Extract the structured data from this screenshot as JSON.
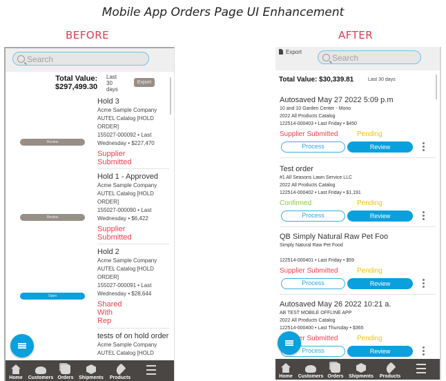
{
  "title": "Mobile App Orders Page UI Enhancement",
  "before": {
    "label": "BEFORE",
    "search_placeholder": "Search",
    "total_label": "Total Value:",
    "total_value": "$297,499.30",
    "period": [
      "Last",
      "30",
      "days"
    ],
    "export_label": "Export",
    "orders": [
      {
        "title": "Hold 3",
        "lines": [
          "Acme Sample Company",
          "AUTEL Catalog [HOLD",
          "ORDER]",
          "155027-000092 • Last",
          "Wednesday • $227,470"
        ],
        "status": [
          "Supplier",
          "Submitted"
        ],
        "action": "Review",
        "action_color": "#978f87"
      },
      {
        "title": "Hold 1 - Approved",
        "lines": [
          "Acme Sample Company",
          "AUTEL Catalog [HOLD",
          "ORDER]",
          "155027-000090 • Last",
          "Wednesday • $6,422"
        ],
        "status": [
          "Supplier",
          "Submitted"
        ],
        "action": "Review",
        "action_color": "#978f87"
      },
      {
        "title": "Hold 2",
        "lines": [
          "Acme Sample Company",
          "AUTEL Catalog [HOLD",
          "ORDER]",
          "155027-000091 • Last",
          "Wednesday • $28,644"
        ],
        "status": [
          "Shared",
          "With",
          "Rep"
        ],
        "action": "Open",
        "action_color": "#0aa0dd"
      },
      {
        "title": "tests of on hold order",
        "lines": [
          "Acme Sample Company",
          "AUTEL Catalog [HOLD"
        ],
        "status": [],
        "action": "",
        "action_color": ""
      }
    ]
  },
  "after": {
    "label": "AFTER",
    "export_label": "Export",
    "search_placeholder": "Search",
    "total_label": "Total Value: $30,339.81",
    "period": "Last 30 days",
    "orders": [
      {
        "title": "Autosaved May 27 2022 5:09 p.m",
        "lines": [
          "10 and 10 Garden Center - Mono",
          "2022 All Products Catalog",
          "122514-000403 • Last Friday • $450"
        ],
        "status1": "Supplier Submitted",
        "status1_color": "#ef3e4a",
        "status2": "Pending",
        "status2_color": "#f2c200"
      },
      {
        "title": "Test order",
        "lines": [
          "#1 All Seasons Lawn Service LLC",
          "2022 All Products Catalog",
          "122514-000402 • Last Friday • $1,191"
        ],
        "status1": "Confirmed",
        "status1_color": "#8cc63f",
        "status2": "Pending",
        "status2_color": "#f2c200"
      },
      {
        "title": "QB Simply Natural Raw Pet Foo",
        "lines": [
          "Simply Natural Raw Pet Food",
          "",
          "122514-000401 • Last Friday • $59"
        ],
        "status1": "Supplier Submitted",
        "status1_color": "#ef3e4a",
        "status2": "Pending",
        "status2_color": "#f2c200"
      },
      {
        "title": "Autosaved May 26 2022 10:21 a.",
        "lines": [
          "AB TEST MOBILE OFFLINE APP",
          "2022 All Products Catalog",
          "122514-000400 • Last Thursday • $365"
        ],
        "status1": "Supplier Submitted",
        "status1_color": "#ef3e4a",
        "status2": "Pending",
        "status2_color": "#f2c200"
      }
    ],
    "process_label": "Process",
    "review_label": "Review"
  },
  "tabbar": [
    {
      "label": "Home",
      "icon": "home-icon"
    },
    {
      "label": "Customers",
      "icon": "customers-icon"
    },
    {
      "label": "Orders",
      "icon": "orders-icon"
    },
    {
      "label": "Shipments",
      "icon": "shipments-icon"
    },
    {
      "label": "Products",
      "icon": "products-icon"
    },
    {
      "label": "",
      "icon": "menu-icon"
    }
  ]
}
